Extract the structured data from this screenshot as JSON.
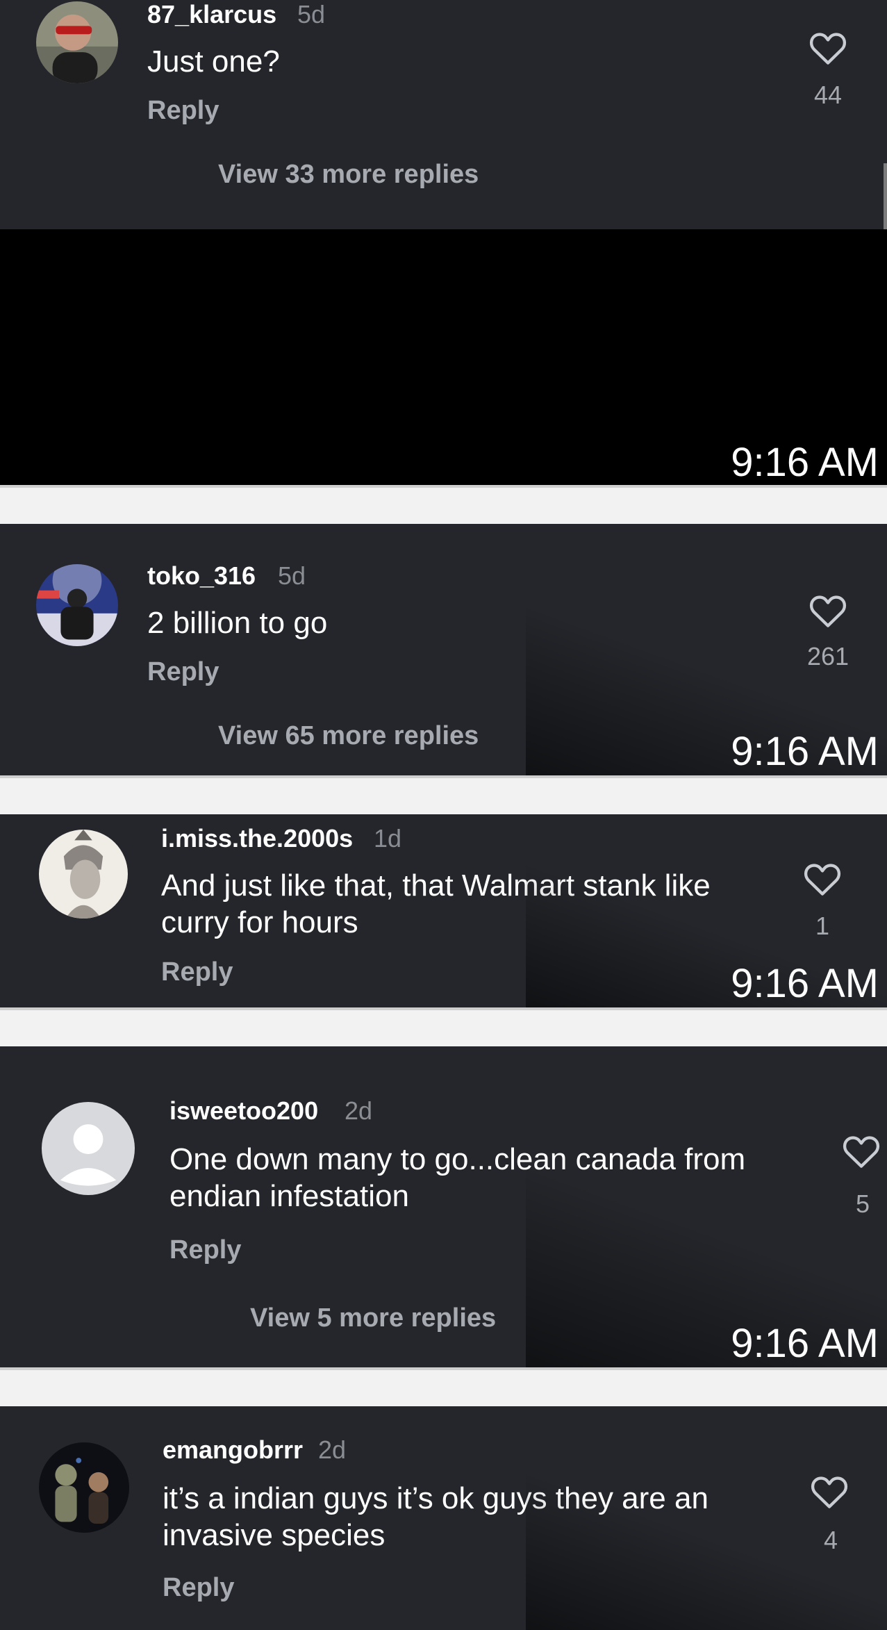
{
  "timestamp": "9:16 AM",
  "comments": [
    {
      "username": "87_klarcus",
      "age": "5d",
      "text": "Just one?",
      "reply": "Reply",
      "likes": "44",
      "more": "View 33 more replies"
    },
    {
      "username": "toko_316",
      "age": "5d",
      "text": "2 billion to go",
      "reply": "Reply",
      "likes": "261",
      "more": "View 65 more replies"
    },
    {
      "username": "i.miss.the.2000s",
      "age": "1d",
      "text": "And just like that, that Walmart stank like\ncurry for hours",
      "reply": "Reply",
      "likes": "1"
    },
    {
      "username": "isweetoo200",
      "age": "2d",
      "text": "One down many to go...clean canada from\nendian infestation",
      "reply": "Reply",
      "likes": "5",
      "more": "View 5 more replies"
    },
    {
      "username": "emangobrrr",
      "age": "2d",
      "text": "it’s a indian guys it’s ok guys they are an\ninvasive species",
      "reply": "Reply",
      "likes": "4"
    }
  ],
  "colors": {
    "panel": "#24262b",
    "separator": "#f2f2f2",
    "muted": "#a7aab0",
    "text": "#ffffff"
  }
}
